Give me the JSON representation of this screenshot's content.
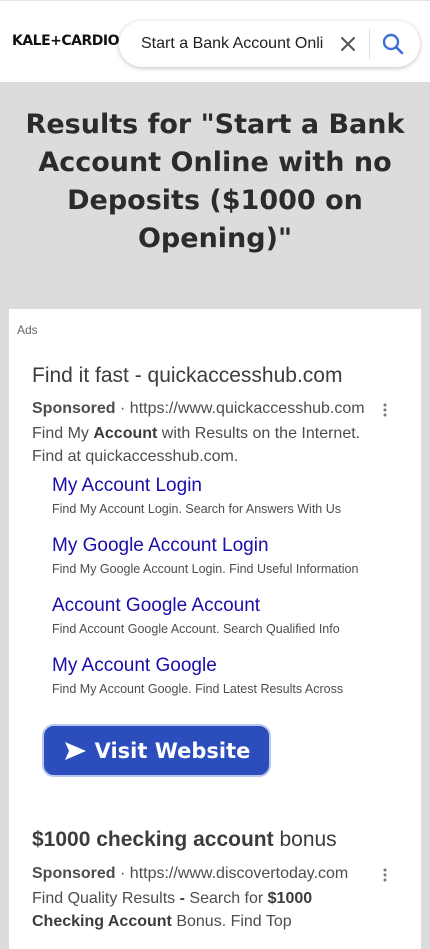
{
  "header": {
    "logo_text": "KALE+CARDIO",
    "search_value": "Start a Bank Account Online",
    "clear_icon": "close-icon",
    "search_icon": "search-icon",
    "accent_color": "#3b6fd6"
  },
  "results_heading": "Results for \"Start a Bank Account Online with no Deposits ($1000 on Opening)\"",
  "ads": {
    "label": "Ads",
    "items": [
      {
        "title": "Find it fast - quickaccesshub.com",
        "sponsored": "Sponsored",
        "separator": "·",
        "url": "https://www.quickaccesshub.com",
        "desc_pre": "Find My ",
        "desc_bold": "Account",
        "desc_post": " with Results on the Internet. Find at quickaccesshub.com.",
        "sitelinks": [
          {
            "title": "My Account Login",
            "desc": "Find My Account Login. Search for Answers With Us"
          },
          {
            "title": "My Google Account Login",
            "desc": "Find My Google Account Login. Find Useful Information"
          },
          {
            "title": "Account Google Account",
            "desc": "Find Account Google Account. Search Qualified Info"
          },
          {
            "title": "My Account Google",
            "desc": "Find My Account Google. Find Latest Results Across"
          }
        ],
        "cta_label": "Visit Website",
        "cta_icon": "send-arrow-icon",
        "cta_color": "#2c4ebd"
      },
      {
        "title_bold": "$1000 checking account",
        "title_rest": " bonus",
        "sponsored": "Sponsored",
        "separator": "·",
        "url": "https://www.discovertoday.com",
        "desc_1": "Find Quality Results ",
        "desc_2": "- ",
        "desc_3": "Search for ",
        "desc_bold_1": "$1000",
        "desc_bold_2": "Checking Account",
        "desc_4": " Bonus. Find Top"
      }
    ]
  }
}
